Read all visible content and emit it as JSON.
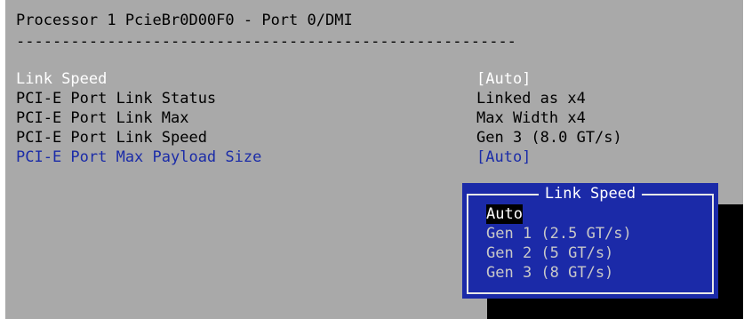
{
  "header": {
    "title": "Processor 1 PcieBr0D00F0 - Port 0/DMI",
    "divider": "-------------------------------------------------------"
  },
  "settings": [
    {
      "label": "Link Speed",
      "value": "[Auto]"
    },
    {
      "label": "PCI-E Port Link Status",
      "value": "Linked as x4"
    },
    {
      "label": "PCI-E Port Link Max",
      "value": "Max Width x4"
    },
    {
      "label": "PCI-E Port Link Speed",
      "value": "Gen 3 (8.0 GT/s)"
    },
    {
      "label": "PCI-E Port Max Payload Size",
      "value": "[Auto]"
    }
  ],
  "popup": {
    "title": "Link Speed",
    "options": [
      "Auto",
      "Gen 1 (2.5 GT/s)",
      "Gen 2 (5 GT/s)",
      "Gen 3 (8 GT/s)"
    ],
    "selected": "Auto"
  },
  "colors": {
    "background": "#a9a9a9",
    "editable_setting": "#ffffff",
    "info_setting": "#000000",
    "highlighted_setting": "#1b2ca8",
    "popup_background": "#1b2aa8"
  }
}
